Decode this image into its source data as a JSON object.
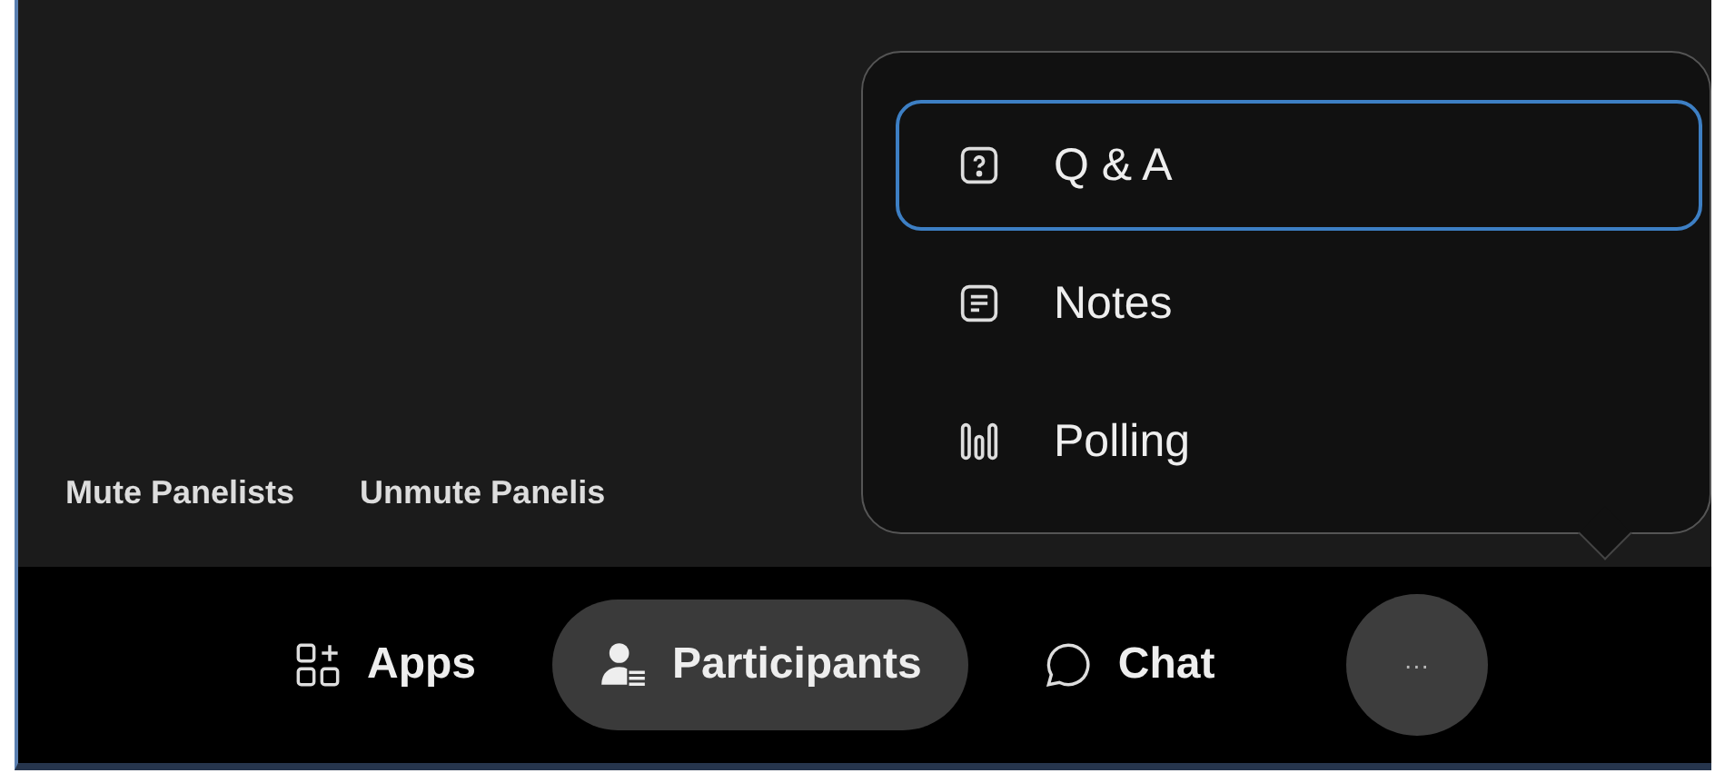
{
  "panel_actions": [
    {
      "label": "Mute Panelists"
    },
    {
      "label": "Unmute Panelis"
    }
  ],
  "toolbar": [
    {
      "kind": "apps",
      "label": "Apps",
      "selected": false
    },
    {
      "kind": "participants",
      "label": "Participants",
      "selected": true
    },
    {
      "kind": "chat",
      "label": "Chat",
      "selected": false
    }
  ],
  "more_button": {
    "label": "···",
    "expanded": true
  },
  "menu": [
    {
      "kind": "qa",
      "label": "Q & A",
      "selected": true
    },
    {
      "kind": "notes",
      "label": "Notes",
      "selected": false
    },
    {
      "kind": "polling",
      "label": "Polling",
      "selected": false
    }
  ]
}
